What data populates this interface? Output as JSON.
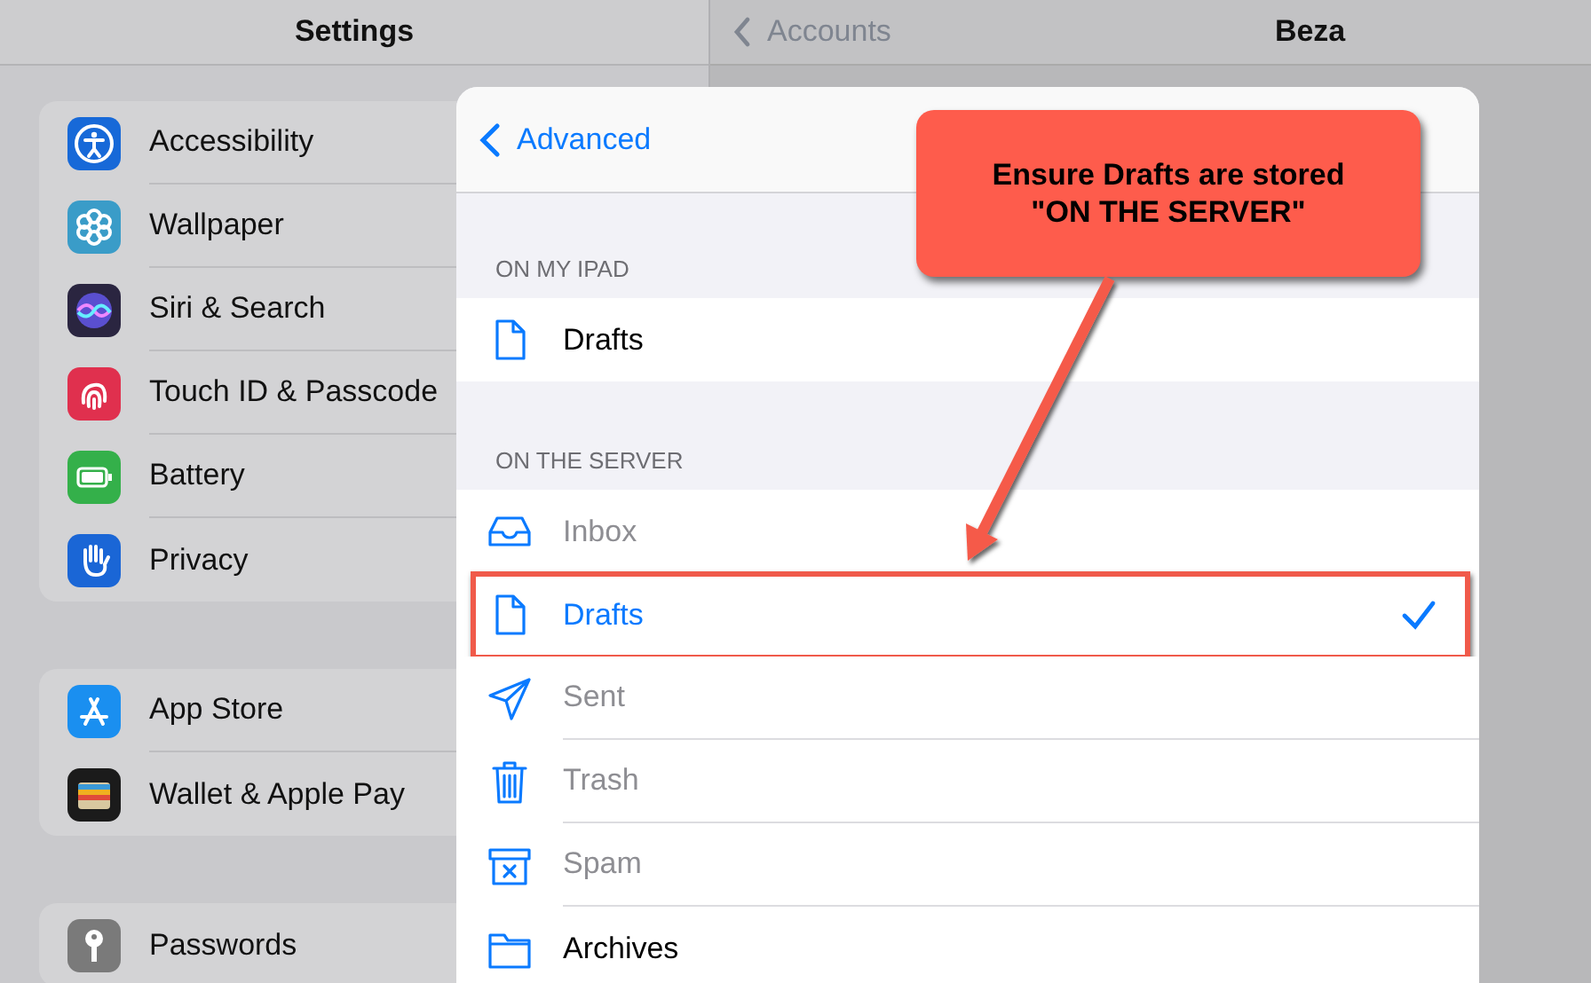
{
  "sidebar": {
    "title": "Settings",
    "groups": [
      {
        "items": [
          {
            "label": "Accessibility",
            "color": "#1769d8"
          },
          {
            "label": "Wallpaper",
            "color": "#3a9cc8"
          },
          {
            "label": "Siri & Search",
            "color": "#2a2540"
          },
          {
            "label": "Touch ID & Passcode",
            "color": "#e0304e"
          },
          {
            "label": "Battery",
            "color": "#34b04a"
          },
          {
            "label": "Privacy",
            "color": "#1a66d6"
          }
        ]
      },
      {
        "items": [
          {
            "label": "App Store",
            "color": "#1a8ff0"
          },
          {
            "label": "Wallet & Apple Pay",
            "color": "#1b1b1b"
          }
        ]
      },
      {
        "items": [
          {
            "label": "Passwords",
            "color": "#7a7a7a"
          }
        ]
      }
    ]
  },
  "detail": {
    "back": "Accounts",
    "title": "Beza"
  },
  "sheet": {
    "back": "Advanced",
    "sections": [
      {
        "header": "ON MY IPAD",
        "folders": [
          {
            "label": "Drafts",
            "selected": false,
            "disabled": false,
            "highlighted": false
          }
        ]
      },
      {
        "header": "ON THE SERVER",
        "folders": [
          {
            "label": "Inbox",
            "selected": false,
            "disabled": true,
            "highlighted": false
          },
          {
            "label": "Drafts",
            "selected": true,
            "disabled": false,
            "highlighted": true
          },
          {
            "label": "Sent",
            "selected": false,
            "disabled": true,
            "highlighted": false
          },
          {
            "label": "Trash",
            "selected": false,
            "disabled": true,
            "highlighted": false
          },
          {
            "label": "Spam",
            "selected": false,
            "disabled": true,
            "highlighted": false
          },
          {
            "label": "Archives",
            "selected": false,
            "disabled": false,
            "highlighted": false
          }
        ]
      }
    ]
  },
  "callout": {
    "text": "Ensure Drafts are stored\n\"ON THE SERVER\""
  }
}
